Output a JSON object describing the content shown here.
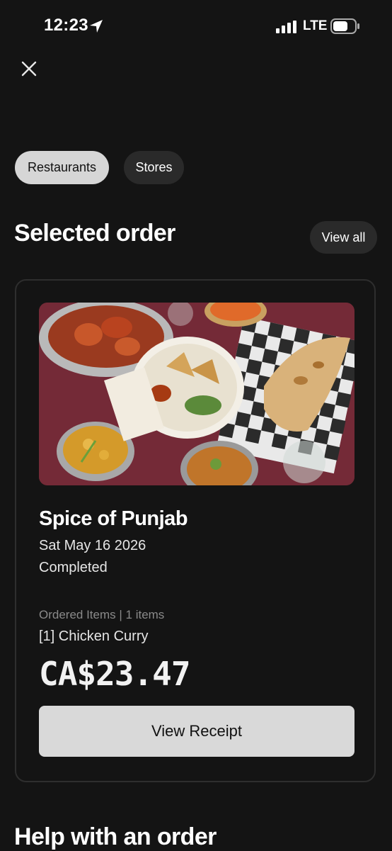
{
  "status_bar": {
    "time": "12:23",
    "network": "LTE",
    "icons": [
      "location-arrow-icon",
      "signal-bars-icon",
      "battery-icon"
    ]
  },
  "header": {
    "close_icon": "close-icon"
  },
  "filters": {
    "chips": [
      {
        "label": "Restaurants",
        "selected": true
      },
      {
        "label": "Stores",
        "selected": false
      }
    ]
  },
  "selected_order": {
    "title": "Selected order",
    "view_all_label": "View all",
    "order": {
      "restaurant": "Spice of Punjab",
      "date": "Sat May 16 2026",
      "status": "Completed",
      "items_summary": "Ordered Items | 1 items",
      "items": [
        "[1] Chicken Curry"
      ],
      "total": "CA$23.47",
      "view_receipt_label": "View Receipt"
    }
  },
  "help_section": {
    "title": "Help with an order"
  },
  "colors": {
    "background": "#141414",
    "chip_selected": "#d6d6d6",
    "chip_unselected": "#2a2a2a",
    "button": "#d9d9d9",
    "card_border": "#2e2e2e"
  }
}
